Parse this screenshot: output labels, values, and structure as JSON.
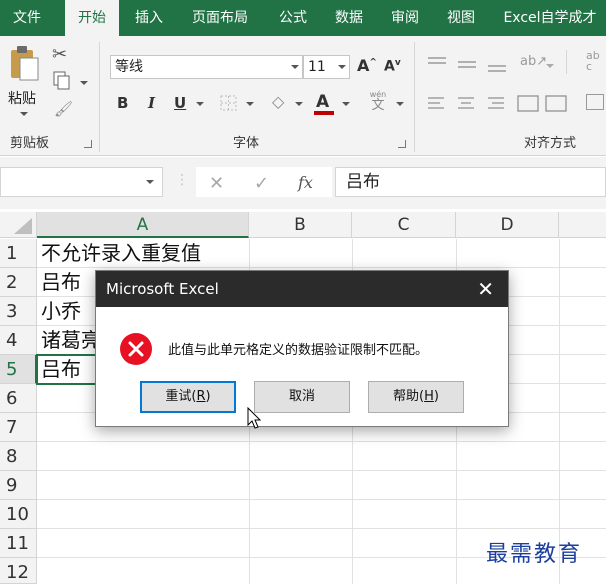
{
  "tabs": [
    {
      "label": "文件",
      "active": false
    },
    {
      "label": "开始",
      "active": true
    },
    {
      "label": "插入",
      "active": false
    },
    {
      "label": "页面布局",
      "active": false
    },
    {
      "label": "公式",
      "active": false
    },
    {
      "label": "数据",
      "active": false
    },
    {
      "label": "审阅",
      "active": false
    },
    {
      "label": "视图",
      "active": false
    },
    {
      "label": "Excel自学成才",
      "active": false
    }
  ],
  "ribbon": {
    "clipboard": {
      "paste_label": "粘贴",
      "group_label": "剪贴板"
    },
    "font": {
      "font_name": "等线",
      "font_size": "11",
      "bold": "B",
      "italic": "I",
      "underline": "U",
      "font_color_glyph": "A",
      "grow_glyph": "A",
      "shrink_glyph": "A",
      "phonetic_top": "wén",
      "phonetic_bottom": "文",
      "group_label": "字体"
    },
    "alignment": {
      "group_label": "对齐方式"
    }
  },
  "formula_bar": {
    "content": "吕布",
    "fx": "fx"
  },
  "grid": {
    "columns": [
      "A",
      "B",
      "C",
      "D"
    ],
    "selected_column": "A",
    "rows": [
      "1",
      "2",
      "3",
      "4",
      "5",
      "6",
      "7",
      "8",
      "9",
      "10",
      "11",
      "12"
    ],
    "selected_row": "5",
    "cells_a": [
      "不允许录入重复值",
      "吕布",
      "小乔",
      "诸葛亮",
      "吕布"
    ]
  },
  "dialog": {
    "title": "Microsoft Excel",
    "close_glyph": "✕",
    "message": "此值与此单元格定义的数据验证限制不匹配。",
    "retry": {
      "text": "重试(",
      "key": "R",
      "end": ")"
    },
    "cancel": "取消",
    "help": {
      "text": "帮助(",
      "key": "H",
      "end": ")"
    }
  },
  "watermark": "最需教育",
  "colors": {
    "excel_green": "#217346",
    "error_red": "#e81123",
    "focus_blue": "#0078d7"
  }
}
